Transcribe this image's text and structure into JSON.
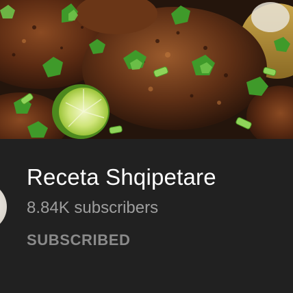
{
  "channel": {
    "name": "Receta Shqipetare",
    "subscribers": "8.84K subscribers",
    "subscribe_state_label": "SUBSCRIBED"
  },
  "banner": {
    "icon": "food-photo-banner"
  },
  "colors": {
    "background": "#212121",
    "title": "#ffffff",
    "secondary_text": "#9e9e9e",
    "subscribed_label": "#8a8a8a"
  }
}
